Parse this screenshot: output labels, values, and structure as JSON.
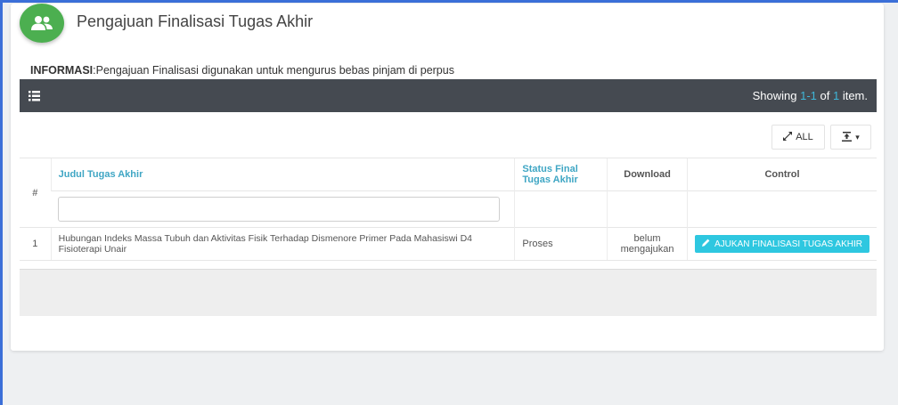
{
  "page": {
    "title": "Pengajuan Finalisasi Tugas Akhir",
    "avatar_icon": "users-icon",
    "accent_color": "#4caf50"
  },
  "info": {
    "label": "INFORMASI",
    "text": ":Pengajuan Finalisasi digunakan untuk mengurus bebas pinjam di perpus"
  },
  "toolbar": {
    "list_icon": "list-icon",
    "showing_prefix": "Showing ",
    "showing_range": "1-1",
    "showing_mid": " of ",
    "showing_total": "1",
    "showing_suffix": " item.",
    "all_label": "ALL",
    "all_icon": "expand-icon",
    "export_icon": "export-icon"
  },
  "table": {
    "headers": {
      "num": "#",
      "judul": "Judul Tugas Akhir",
      "status": "Status Final Tugas Akhir",
      "download": "Download",
      "control": "Control"
    },
    "filter_placeholder": "",
    "rows": [
      {
        "num": "1",
        "judul": "Hubungan Indeks Massa Tubuh dan Aktivitas Fisik Terhadap Dismenore Primer Pada Mahasiswi D4 Fisioterapi Unair",
        "status": "Proses",
        "download": "belum mengajukan",
        "action": "AJUKAN FINALISASI TUGAS AKHIR"
      }
    ]
  }
}
